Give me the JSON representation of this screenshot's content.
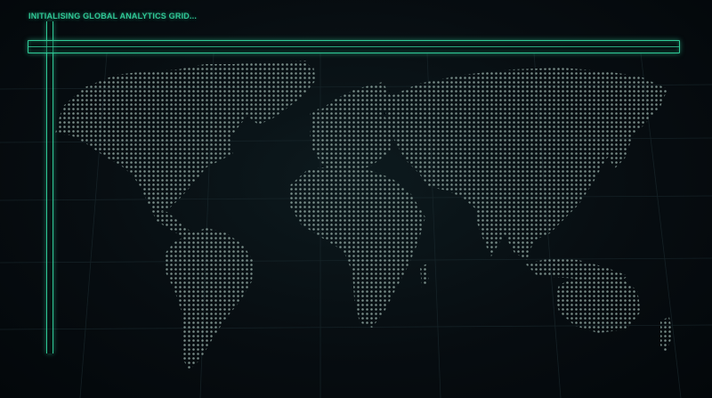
{
  "status": {
    "text": "INITIALISING GLOBAL ANALYTICS GRID..."
  },
  "theme": {
    "accent": "#2fc896",
    "background": "#05090c",
    "dot_color": "#8fa6a0",
    "grid_color": "#1b2a2f"
  },
  "map": {
    "icon": "world-dot-map",
    "loading": true
  }
}
